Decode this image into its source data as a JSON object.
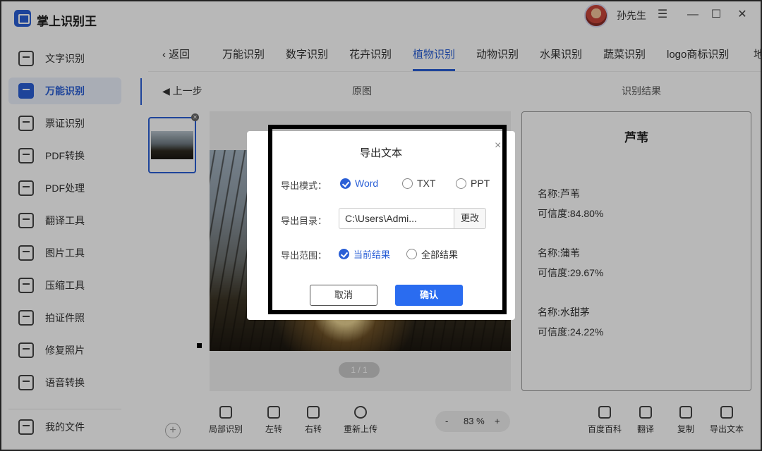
{
  "app": {
    "title": "掌上识别王",
    "username": "孙先生"
  },
  "window": {
    "menu_icon": "menu-icon",
    "minimize_icon": "minimize-icon",
    "maximize_icon": "maximize-icon",
    "close_icon": "close-icon"
  },
  "sidebar": {
    "items": [
      {
        "label": "文字识别"
      },
      {
        "label": "万能识别",
        "active": true
      },
      {
        "label": "票证识别"
      },
      {
        "label": "PDF转换"
      },
      {
        "label": "PDF处理"
      },
      {
        "label": "翻译工具"
      },
      {
        "label": "图片工具"
      },
      {
        "label": "压缩工具"
      },
      {
        "label": "拍证件照"
      },
      {
        "label": "修复照片"
      },
      {
        "label": "语音转换"
      }
    ],
    "my_files": "我的文件"
  },
  "tabs": {
    "back": "返回",
    "items": [
      "万能识别",
      "数字识别",
      "花卉识别",
      "植物识别",
      "动物识别",
      "水果识别",
      "蔬菜识别",
      "logo商标识别",
      "地"
    ],
    "active": "植物识别"
  },
  "subheader": {
    "prev_step": "上一步",
    "original": "原图",
    "result": "识别结果"
  },
  "viewer": {
    "page_indicator": "1 / 1"
  },
  "result": {
    "title": "芦苇",
    "items": [
      {
        "name": "名称:芦苇",
        "confidence": "可信度:84.80%"
      },
      {
        "name": "名称:蒲苇",
        "confidence": "可信度:29.67%"
      },
      {
        "name": "名称:水甜茅",
        "confidence": "可信度:24.22%"
      }
    ]
  },
  "toolbar": {
    "partial": "局部识别",
    "rotate_left": "左转",
    "rotate_right": "右转",
    "reupload": "重新上传",
    "zoom_minus": "-",
    "zoom_value": "83 %",
    "zoom_plus": "+",
    "baike": "百度百科",
    "translate": "翻译",
    "copy": "复制",
    "export": "导出文本"
  },
  "dialog": {
    "title": "导出文本",
    "close": "×",
    "mode_label": "导出模式：",
    "modes": [
      "Word",
      "TXT",
      "PPT"
    ],
    "selected_mode": "Word",
    "dir_label": "导出目录：",
    "dir_value": "C:\\Users\\Admi...",
    "change": "更改",
    "range_label": "导出范围：",
    "ranges": [
      "当前结果",
      "全部结果"
    ],
    "selected_range": "当前结果",
    "cancel": "取消",
    "confirm": "确认"
  },
  "colors": {
    "accent": "#2a5fd6",
    "confirm_button": "#2a6cf0"
  }
}
